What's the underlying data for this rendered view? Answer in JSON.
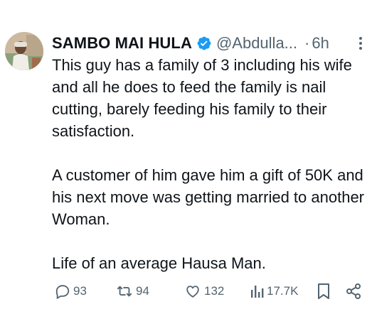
{
  "author": {
    "name": "SAMBO MAI HULA",
    "handle": "@Abdulla...",
    "verified": true,
    "avatar": "avatar-photo"
  },
  "meta": {
    "separator": "·",
    "time": "6h"
  },
  "tweet": {
    "paragraphs": [
      "This guy has a family of 3 including his wife and all he does to feed the family is nail cutting, barely feeding his family to their satisfaction.",
      "A customer of him gave him a gift of 50K and his next move was getting married to another Woman.",
      "Life of an average Hausa Man."
    ]
  },
  "actions": {
    "replies": "93",
    "reposts": "94",
    "likes": "132",
    "views": "17.7K",
    "icons": [
      "reply-icon",
      "repost-icon",
      "like-icon",
      "views-icon",
      "bookmark-icon",
      "share-icon"
    ]
  },
  "colors": {
    "text": "#0f1419",
    "secondary": "#536471",
    "verified": "#1d9bf0",
    "background": "#ffffff"
  }
}
